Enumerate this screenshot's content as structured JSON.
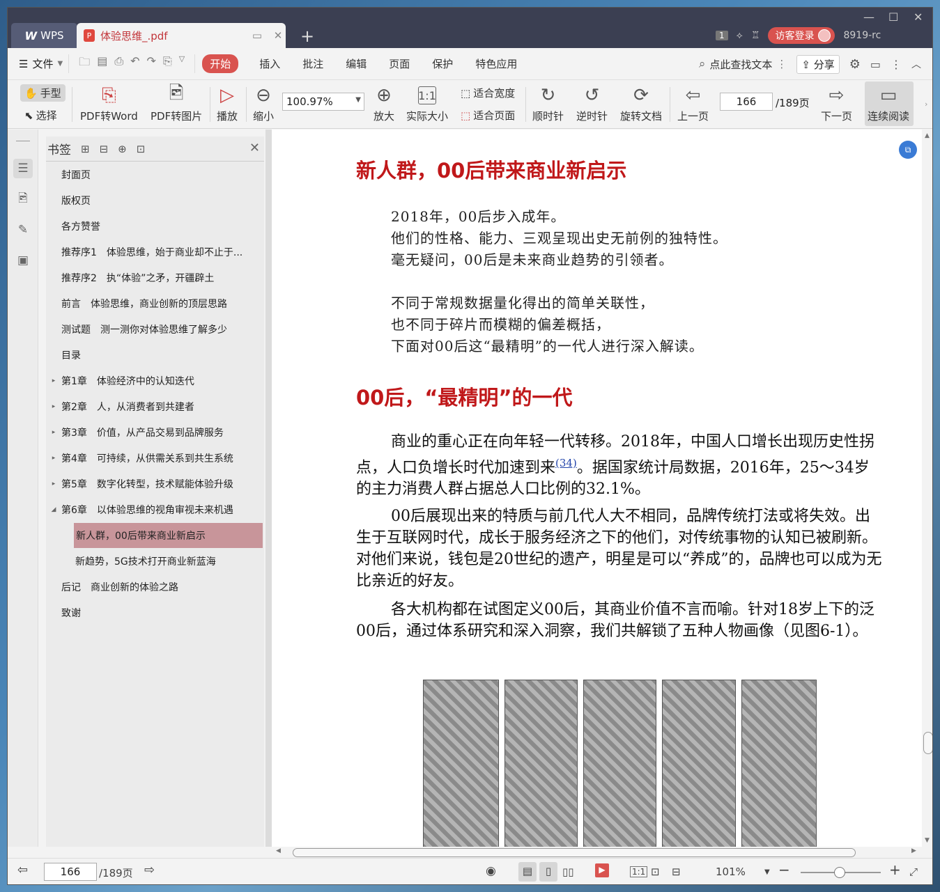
{
  "app": {
    "brand": "WPS",
    "tab_title": "体验思维_.pdf",
    "user_login": "访客登录",
    "user_id": "8919-rc",
    "page_badge": "1"
  },
  "window_controls": {
    "minimize": "—",
    "maximize": "☐",
    "close": "✕"
  },
  "menu": {
    "file": "文件",
    "active": "开始",
    "items": [
      "插入",
      "批注",
      "编辑",
      "页面",
      "保护",
      "特色应用"
    ],
    "search": "点此查找文本",
    "share": "分享"
  },
  "toolbar": {
    "hand": "手型",
    "select": "选择",
    "pdf_to_word": "PDF转Word",
    "pdf_to_image": "PDF转图片",
    "play": "播放",
    "zoom_out": "缩小",
    "zoom_value": "100.97%",
    "zoom_in": "放大",
    "actual_size": "实际大小",
    "fit_width": "适合宽度",
    "fit_page": "适合页面",
    "clockwise": "顺时针",
    "counterclockwise": "逆时针",
    "rotate_doc": "旋转文档",
    "prev_page": "上一页",
    "page_current": "166",
    "page_total": "/189页",
    "next_page": "下一页",
    "continuous": "连续阅读"
  },
  "bookmarks": {
    "title": "书签",
    "items": [
      {
        "label": "封面页",
        "expand": ""
      },
      {
        "label": "版权页",
        "expand": ""
      },
      {
        "label": "各方赞誉",
        "expand": ""
      },
      {
        "label": "推荐序1　体验思维，始于商业却不止于...",
        "expand": ""
      },
      {
        "label": "推荐序2　执“体验”之矛，开疆辟土",
        "expand": ""
      },
      {
        "label": "前言　体验思维，商业创新的顶层思路",
        "expand": ""
      },
      {
        "label": "测试题　测一测你对体验思维了解多少",
        "expand": ""
      },
      {
        "label": "目录",
        "expand": ""
      },
      {
        "label": "第1章　体验经济中的认知迭代",
        "expand": "▸"
      },
      {
        "label": "第2章　人，从消费者到共建者",
        "expand": "▸"
      },
      {
        "label": "第3章　价值，从产品交易到品牌服务",
        "expand": "▸"
      },
      {
        "label": "第4章　可持续，从供需关系到共生系统",
        "expand": "▸"
      },
      {
        "label": "第5章　数字化转型，技术赋能体验升级",
        "expand": "▸"
      },
      {
        "label": "第6章　以体验思维的视角审视未来机遇",
        "expand": "◢"
      },
      {
        "label": "新人群，00后带来商业新启示",
        "expand": "",
        "active": true
      },
      {
        "label": "新趋势，5G技术打开商业新蓝海",
        "expand": ""
      },
      {
        "label": "后记　商业创新的体验之路",
        "expand": ""
      },
      {
        "label": "致谢",
        "expand": ""
      }
    ]
  },
  "document": {
    "heading1": "新人群，00后带来商业新启示",
    "poem": [
      "2018年，00后步入成年。",
      "他们的性格、能力、三观呈现出史无前例的独特性。",
      "毫无疑问，00后是未来商业趋势的引领者。",
      "",
      "不同于常规数据量化得出的简单关联性，",
      "也不同于碎片而模糊的偏差概括，",
      "下面对00后这“最精明”的一代人进行深入解读。"
    ],
    "heading2": "00后，“最精明”的一代",
    "para1_a": "商业的重心正在向年轻一代转移。2018年，中国人口增长出现历史性拐点，人口负增长时代加速到来",
    "para1_ref": "(34)",
    "para1_b": "。据国家统计局数据，2016年，25～34岁的主力消费人群占据总人口比例的32.1%。",
    "para2": "00后展现出来的特质与前几代人大不相同，品牌传统打法或将失效。出生于互联网时代，成长于服务经济之下的他们，对传统事物的认知已被刷新。对他们来说，钱包是20世纪的遗产，明星是可以“养成”的，品牌也可以成为无比亲近的好友。",
    "para3": "各大机构都在试图定义00后，其商业价值不言而喻。针对18岁上下的泛00后，通过体系研究和深入洞察，我们共解锁了五种人物画像（见图6-1）。"
  },
  "status": {
    "page_current": "166",
    "page_total": "/189页",
    "zoom": "101%"
  }
}
